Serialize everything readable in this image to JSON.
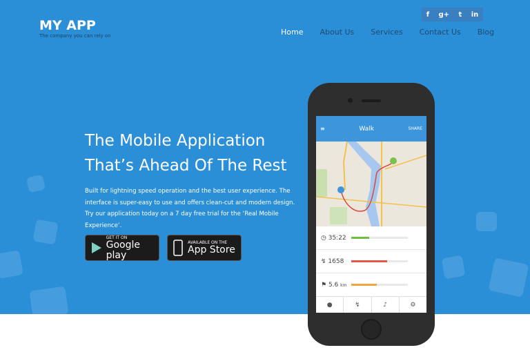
{
  "header": {
    "logo": "MY APP",
    "tagline": "The company you can rely on",
    "social": [
      {
        "icon": "facebook-icon",
        "glyph": "f"
      },
      {
        "icon": "google-plus-icon",
        "glyph": "g+"
      },
      {
        "icon": "twitter-icon",
        "glyph": "t"
      },
      {
        "icon": "linkedin-icon",
        "glyph": "in"
      }
    ],
    "nav": [
      "Home",
      "About Us",
      "Services",
      "Contact Us",
      "Blog"
    ],
    "active": "Home"
  },
  "hero": {
    "title_line1": "The Mobile Application",
    "title_line2": "That’s Ahead Of The Rest",
    "description": "Built for lightning speed operation and the best user experience. The interface is super-easy to use and offers clean-cut and modern design. Try our application today on a 7 day free trial for the ‘Real Mobile Experience’.",
    "google_play": {
      "small": "GET IT ON",
      "big": "Google play"
    },
    "app_store": {
      "small": "AVAILABLE ON THE",
      "big": "App Store"
    }
  },
  "phone_app": {
    "title": "Walk",
    "share": "SHARE",
    "stats": [
      {
        "icon": "clock-icon",
        "value": "35:22",
        "unit": "",
        "progress": 0.32,
        "color": "#6cbf3d"
      },
      {
        "icon": "steps-icon",
        "value": "1658",
        "unit": "",
        "progress": 0.64,
        "color": "#e0584b"
      },
      {
        "icon": "flag-icon",
        "value": "5.6",
        "unit": "km",
        "progress": 0.45,
        "color": "#f0a73a"
      }
    ],
    "tabs": [
      "info-icon",
      "activity-icon",
      "bell-icon",
      "settings-icon"
    ]
  },
  "colors": {
    "brand": "#2b8fd8",
    "nav_text": "#1f4a70"
  }
}
